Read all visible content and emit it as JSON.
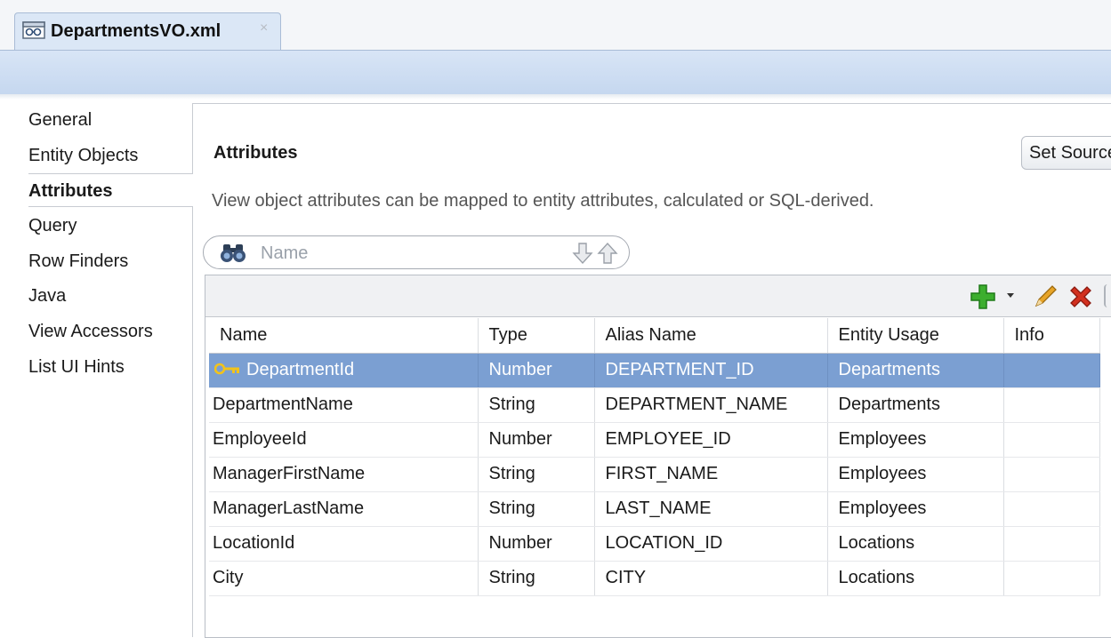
{
  "editor_tab": {
    "title": "DepartmentsVO.xml",
    "close_label": "×"
  },
  "nav": {
    "items": [
      {
        "label": "General",
        "active": false
      },
      {
        "label": "Entity Objects",
        "active": false
      },
      {
        "label": "Attributes",
        "active": true
      },
      {
        "label": "Query",
        "active": false
      },
      {
        "label": "Row Finders",
        "active": false
      },
      {
        "label": "Java",
        "active": false
      },
      {
        "label": "View Accessors",
        "active": false
      },
      {
        "label": "List UI Hints",
        "active": false
      }
    ]
  },
  "main": {
    "title": "Attributes",
    "set_source_label": "Set Source",
    "description": "View object attributes can be mapped to entity attributes, calculated or SQL-derived.",
    "search": {
      "placeholder": "Name",
      "value": ""
    }
  },
  "toolbar": {
    "icons": [
      "add-icon",
      "dropdown-arrow-icon",
      "edit-pencil-icon",
      "delete-x-icon"
    ],
    "colors": {
      "add": "#3cae2e",
      "edit": "#e7a428",
      "delete": "#d2301f"
    }
  },
  "table": {
    "columns": [
      "Name",
      "Type",
      "Alias Name",
      "Entity Usage",
      "Info"
    ],
    "rows": [
      {
        "name": "DepartmentId",
        "type": "Number",
        "alias": "DEPARTMENT_ID",
        "entity": "Departments",
        "info": "",
        "key": true,
        "selected": true
      },
      {
        "name": "DepartmentName",
        "type": "String",
        "alias": "DEPARTMENT_NAME",
        "entity": "Departments",
        "info": ""
      },
      {
        "name": "EmployeeId",
        "type": "Number",
        "alias": "EMPLOYEE_ID",
        "entity": "Employees",
        "info": ""
      },
      {
        "name": "ManagerFirstName",
        "type": "String",
        "alias": "FIRST_NAME",
        "entity": "Employees",
        "info": ""
      },
      {
        "name": "ManagerLastName",
        "type": "String",
        "alias": "LAST_NAME",
        "entity": "Employees",
        "info": ""
      },
      {
        "name": "LocationId",
        "type": "Number",
        "alias": "LOCATION_ID",
        "entity": "Locations",
        "info": ""
      },
      {
        "name": "City",
        "type": "String",
        "alias": "CITY",
        "entity": "Locations",
        "info": ""
      }
    ],
    "selection_color": "#7b9fd2"
  }
}
